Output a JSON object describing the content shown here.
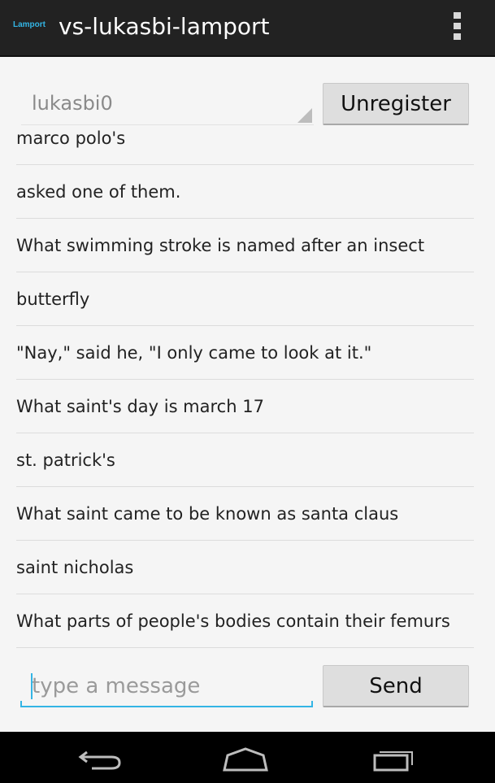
{
  "action_bar": {
    "app_icon_text": "Lamport",
    "title": "vs-lukasbi-lamport",
    "overflow_icon": "overflow-menu-icon"
  },
  "registration": {
    "selected_user": "lukasbi0",
    "unregister_label": "Unregister"
  },
  "messages": [
    "marco polo's",
    "asked one of them.",
    "What swimming stroke is named after an insect",
    "butterfly",
    "\"Nay,\" said he, \"I only came to look at it.\"",
    "What saint's day is march 17",
    "st. patrick's",
    "What saint came to be known as santa claus",
    "saint nicholas",
    "What parts of people's bodies contain their femurs"
  ],
  "composer": {
    "placeholder": "type a message",
    "value": "",
    "send_label": "Send"
  },
  "colors": {
    "action_bar_bg": "#222222",
    "accent": "#33b5e5",
    "background": "#f5f5f5",
    "nav_bar_bg": "#000000"
  },
  "nav": {
    "back_icon": "back-icon",
    "home_icon": "home-icon",
    "recent_icon": "recent-apps-icon"
  }
}
